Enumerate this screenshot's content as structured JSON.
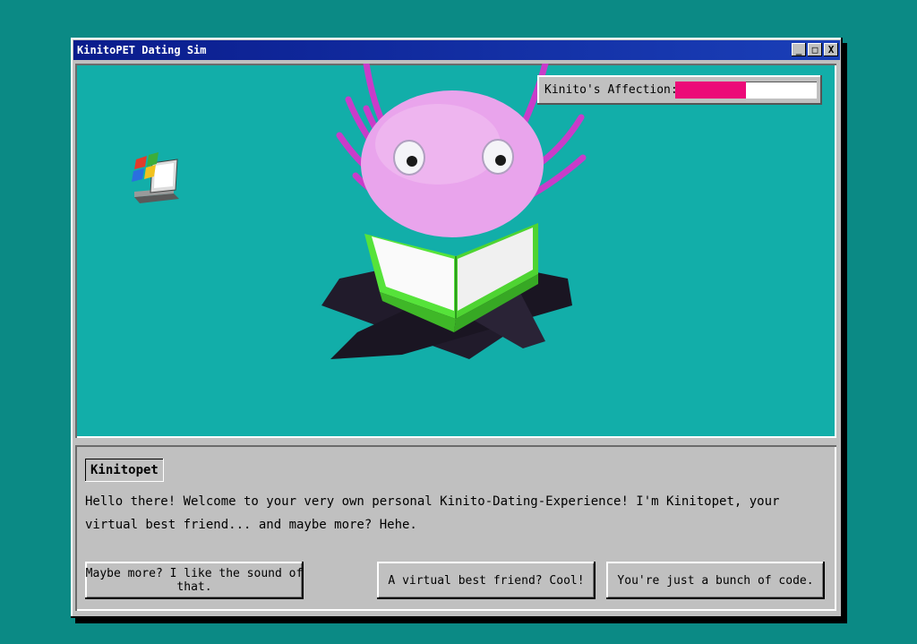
{
  "window": {
    "title": "KinitoPET Dating Sim",
    "controls": {
      "minimize": "_",
      "maximize": "□",
      "close": "X"
    }
  },
  "affection": {
    "label": "Kinito's Affection:",
    "level": 0.5,
    "fill_color": "#ec0a78"
  },
  "dialog": {
    "speaker": "Kinitopet",
    "line1": "Hello there! Welcome to your very own personal Kinito-Dating-Experience! I'm Kinitopet, your",
    "line2": "virtual best friend... and maybe more? Hehe."
  },
  "choices": [
    {
      "label": "Maybe more? I like the sound of that."
    },
    {
      "label": "A virtual best friend? Cool!"
    },
    {
      "label": "You're just a bunch of code."
    }
  ],
  "icons": {
    "desktop": "computer-icon",
    "character": "kinito-character"
  },
  "colors": {
    "background": "#0b8a85",
    "scene": "#12aea9",
    "titlebar": "#0a1c8c",
    "creature": "#e9a4ec",
    "book": "#56e33a"
  }
}
